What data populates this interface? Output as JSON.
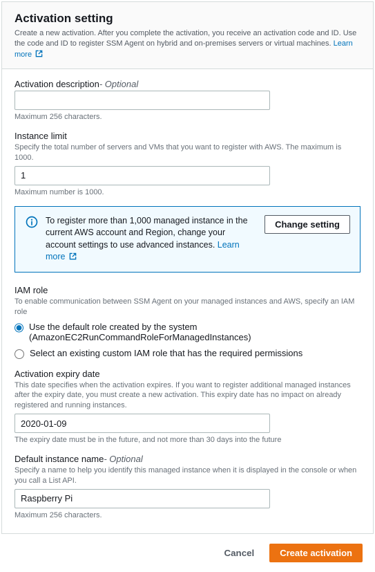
{
  "header": {
    "title": "Activation setting",
    "description": "Create a new activation. After you complete the activation, you receive an activation code and ID. Use the code and ID to register SSM Agent on hybrid and on-premises servers or virtual machines.",
    "learn_more": "Learn more"
  },
  "fields": {
    "activation_desc": {
      "label": "Activation description",
      "optional": "- Optional",
      "value": "",
      "hint": "Maximum 256 characters."
    },
    "instance_limit": {
      "label": "Instance limit",
      "desc": "Specify the total number of servers and VMs that you want to register with AWS. The maximum is 1000.",
      "value": "1",
      "hint": "Maximum number is 1000."
    },
    "iam_role": {
      "label": "IAM role",
      "desc": "To enable communication between SSM Agent on your managed instances and AWS, specify an IAM role",
      "option_default": "Use the default role created by the system (AmazonEC2RunCommandRoleForManagedInstances)",
      "option_custom": "Select an existing custom IAM role that has the required permissions"
    },
    "expiry": {
      "label": "Activation expiry date",
      "desc": "This date specifies when the activation expires. If you want to register additional managed instances after the expiry date, you must create a new activation. This expiry date has no impact on already registered and running instances.",
      "value": "2020-01-09",
      "hint": "The expiry date must be in the future, and not more than 30 days into the future"
    },
    "default_name": {
      "label": "Default instance name",
      "optional": "- Optional",
      "desc": "Specify a name to help you identify this managed instance when it is displayed in the console or when you call a List API.",
      "value": "Raspberry Pi",
      "hint": "Maximum 256 characters."
    }
  },
  "info_box": {
    "text": "To register more than 1,000 managed instance in the current AWS account and Region, change your account settings to use advanced instances.",
    "learn_more": "Learn more",
    "button": "Change setting"
  },
  "footer": {
    "cancel": "Cancel",
    "submit": "Create activation"
  }
}
